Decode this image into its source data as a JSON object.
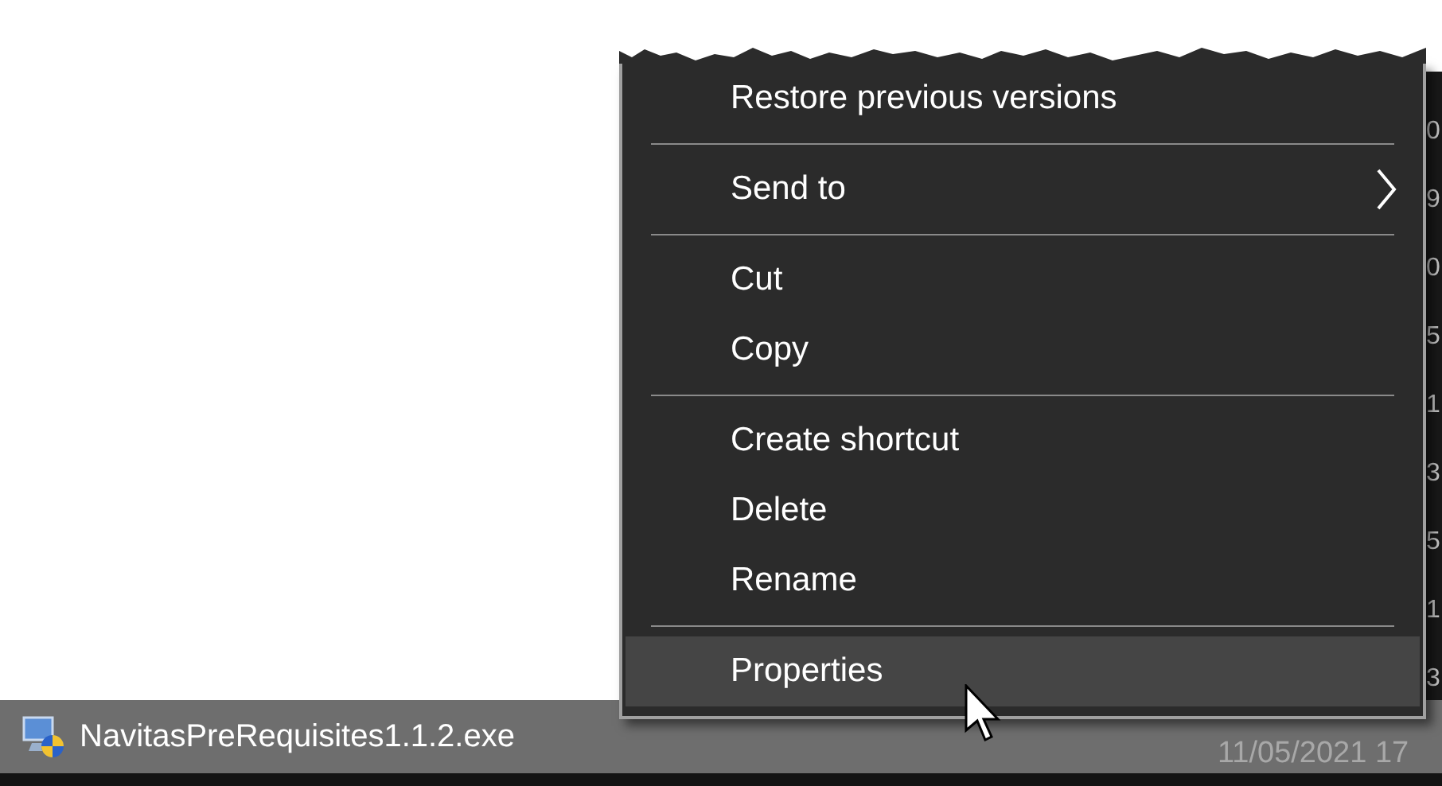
{
  "file_list": {
    "column_edge": [
      "0",
      "9",
      "0",
      "5",
      "1",
      "3",
      "5",
      "1",
      "3"
    ],
    "selected_row": {
      "name": "NavitasPreRequisites1.1.2.exe",
      "date": "11/05/2021 17"
    }
  },
  "context_menu": {
    "items": [
      {
        "kind": "item",
        "label": "Restore previous versions",
        "selected": false
      },
      {
        "kind": "separator"
      },
      {
        "kind": "submenu",
        "label": "Send to",
        "selected": false
      },
      {
        "kind": "separator"
      },
      {
        "kind": "item",
        "label": "Cut",
        "selected": false
      },
      {
        "kind": "item",
        "label": "Copy",
        "selected": false
      },
      {
        "kind": "separator"
      },
      {
        "kind": "item",
        "label": "Create shortcut",
        "selected": false
      },
      {
        "kind": "item",
        "label": "Delete",
        "selected": false
      },
      {
        "kind": "item",
        "label": "Rename",
        "selected": false
      },
      {
        "kind": "separator"
      },
      {
        "kind": "item",
        "label": "Properties",
        "selected": true
      }
    ]
  }
}
